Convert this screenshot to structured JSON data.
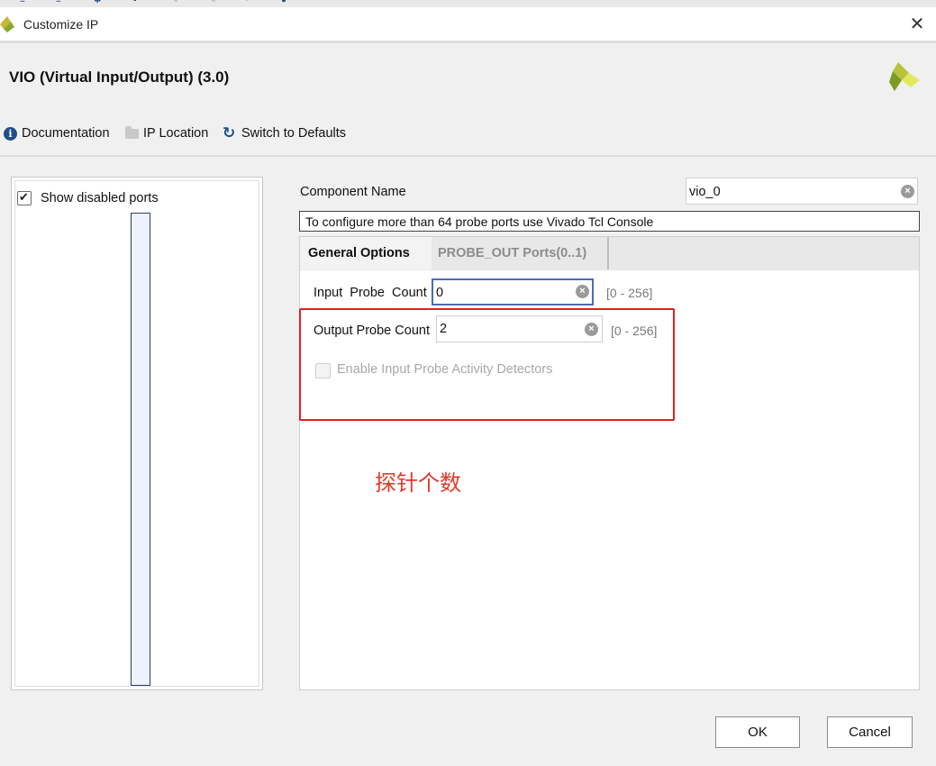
{
  "window": {
    "title": "Customize IP"
  },
  "header": {
    "ip_title": "VIO (Virtual Input/Output) (3.0)"
  },
  "toolbar": {
    "documentation": "Documentation",
    "ip_location": "IP Location",
    "switch_defaults": "Switch to Defaults"
  },
  "left_panel": {
    "show_disabled_ports": "Show disabled ports",
    "show_disabled_checked": true
  },
  "component": {
    "label": "Component Name",
    "value": "vio_0"
  },
  "note": "To configure more than 64 probe ports use Vivado Tcl Console",
  "tabs": [
    {
      "label": "General Options",
      "active": true
    },
    {
      "label": "PROBE_OUT Ports(0..1)",
      "active": false
    }
  ],
  "fields": {
    "input_probe": {
      "label": "Input  Probe  Count",
      "value": "0",
      "range": "[0 - 256]"
    },
    "output_probe": {
      "label": "Output Probe Count",
      "value": "2",
      "range": "[0 - 256]"
    }
  },
  "enable_detectors": {
    "label": "Enable Input Probe Activity Detectors",
    "checked": false
  },
  "annotation": "探针个数",
  "buttons": {
    "ok": "OK",
    "cancel": "Cancel"
  },
  "colors": {
    "accent": "#1f4e8c",
    "annotation": "#e23a2a",
    "focus_border": "#4a6cb3"
  }
}
